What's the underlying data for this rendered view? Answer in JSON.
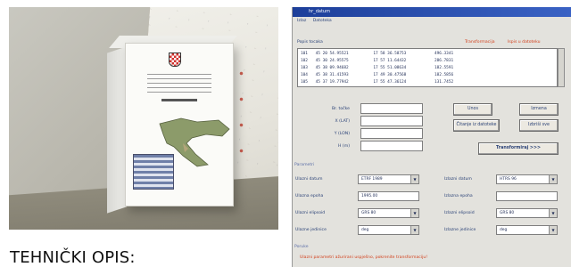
{
  "caption": "TEHNIČKI OPIS:",
  "window": {
    "title": "hr_datum",
    "menu": [
      "Izlaz",
      "Datoteka"
    ]
  },
  "coordinate_list": {
    "label": "Popis tocaka",
    "red_labels": [
      "Transformacija",
      "Ispis u datoteku"
    ],
    "rows": [
      {
        "id": "101",
        "lat": "45 20 54.95521",
        "lon": "17 58 36.58753",
        "val": "496.3341"
      },
      {
        "id": "102",
        "lat": "45 30 24.95575",
        "lon": "17 57 11.64432",
        "val": "286.7831"
      },
      {
        "id": "103",
        "lat": "45 38 09.94682",
        "lon": "17 55 51.08634",
        "val": "182.5591"
      },
      {
        "id": "104",
        "lat": "45 38 31.41593",
        "lon": "17 49 30.47568",
        "val": "182.5856"
      },
      {
        "id": "105",
        "lat": "45 37 19.77942",
        "lon": "17 55 47.36124",
        "val": "131.7452"
      }
    ]
  },
  "point_form": {
    "fields": [
      {
        "label": "Br. točke"
      },
      {
        "label": "X (LAT)"
      },
      {
        "label": "Y (LON)"
      },
      {
        "label": "H (m)"
      }
    ],
    "buttons": {
      "unos": "Unos",
      "izmena": "Izmena",
      "citanje": "Čitanje iz datoteke",
      "brisanje": "Izbriši sve",
      "transform": "Transformiraj >>>"
    }
  },
  "parameters": {
    "label": "Parametri",
    "rows": [
      {
        "left_label": "Ulazni datum",
        "left_value": "ETRF 1989",
        "right_label": "Izlazni datum",
        "right_value": "HTRS 96"
      },
      {
        "left_label": "Ulazna epoha",
        "left_value": "1995.00",
        "right_label": "Izlazna epoha",
        "right_value": ""
      },
      {
        "left_label": "Ulazni elipsoid",
        "left_value": "GRS 80",
        "right_label": "Izlazni elipsoid",
        "right_value": "GRS 80"
      },
      {
        "left_label": "Ulazne jedinice",
        "left_value": "deg",
        "right_label": "Izlazne jedinice",
        "right_value": "deg"
      }
    ]
  },
  "messages": {
    "label": "Poruke",
    "text": "Ulazni parametri ažurirani uspješno, pokrenite transformaciju!"
  }
}
